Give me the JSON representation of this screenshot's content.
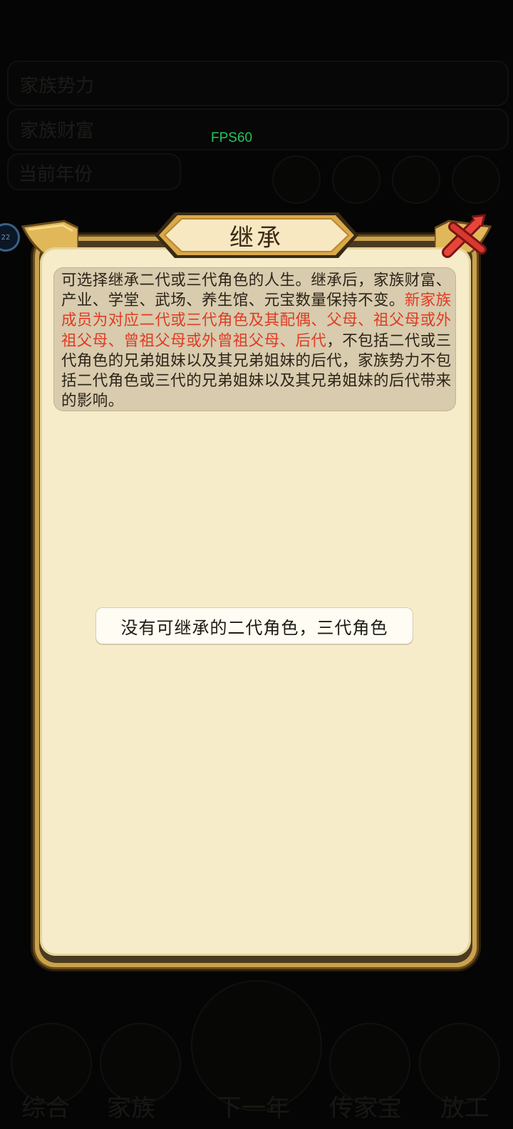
{
  "overlay": {
    "fps_label": "FPS60"
  },
  "background": {
    "row1_left": "家族势力",
    "row2_left": "家族财富",
    "row3_left": "当前年份",
    "bottom_nav": [
      "综合",
      "家族",
      "下一年",
      "传家宝",
      "放工"
    ]
  },
  "dialog": {
    "title": "继承",
    "description_black_1": "可选择继承二代或三代角色的人生。继承后，家族财富、产业、学堂、武场、养生馆、元宝数量保持不变。",
    "description_red": "新家族成员为对应二代或三代角色及其配偶、父母、祖父母或外祖父母、曾祖父母或外曾祖父母、后代",
    "description_black_2": "，不包括二代或三代角色的兄弟姐妹以及其兄弟姐妹的后代，家族势力不包括二代角色或三代的兄弟姐妹以及其兄弟姐妹的后代带来的影响。",
    "empty_message": "没有可继承的二代角色，三代角色"
  },
  "colors": {
    "highlight_red": "#e03c22",
    "panel_bg": "#f6ecc9",
    "frame_gold": "#c9a24c"
  }
}
